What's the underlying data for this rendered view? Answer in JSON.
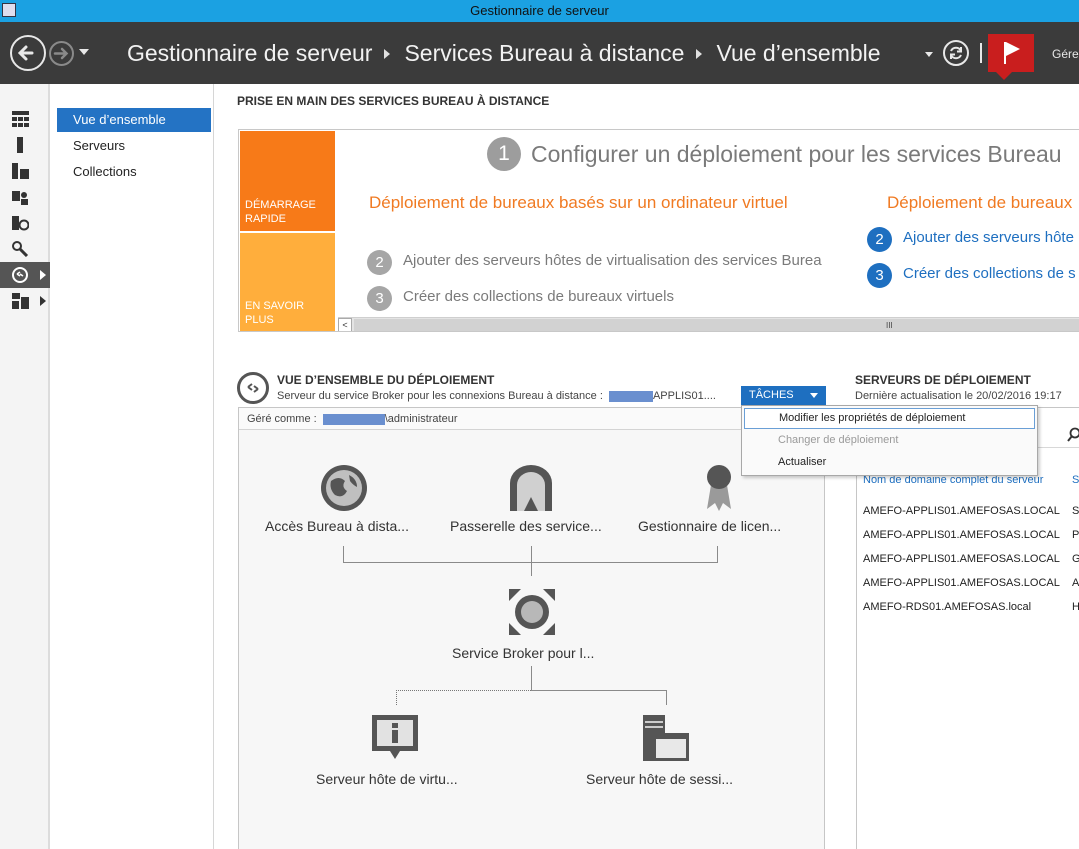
{
  "window": {
    "title": "Gestionnaire de serveur"
  },
  "header": {
    "breadcrumb": [
      "Gestionnaire de serveur",
      "Services Bureau à distance",
      "Vue d’ensemble"
    ],
    "manage_label": "Gére"
  },
  "sidenav": {
    "items": [
      {
        "label": "Vue d’ensemble",
        "active": true
      },
      {
        "label": "Serveurs",
        "active": false
      },
      {
        "label": "Collections",
        "active": false
      }
    ]
  },
  "quickstart": {
    "section_title": "PRISE EN MAIN DES SERVICES BUREAU À DISTANCE",
    "tile_quick": [
      "DÉMARRAGE",
      "RAPIDE"
    ],
    "tile_learn": [
      "EN SAVOIR",
      "PLUS"
    ],
    "main_step_num": "1",
    "main_step_text": "Configurer un déploiement pour les services Bureau",
    "col1_heading": "Déploiement de bureaux basés sur un ordinateur virtuel",
    "col1_steps": [
      {
        "num": "2",
        "text": "Ajouter des serveurs hôtes de virtualisation des services Burea"
      },
      {
        "num": "3",
        "text": "Créer des collections de bureaux virtuels"
      }
    ],
    "col2_heading": "Déploiement de bureaux",
    "col2_steps": [
      {
        "num": "2",
        "text": "Ajouter des serveurs hôte"
      },
      {
        "num": "3",
        "text": "Créer des collections de s"
      }
    ],
    "scroll_left": "<",
    "scroll_grip": "III"
  },
  "deployment": {
    "title": "VUE D’ENSEMBLE DU DÉPLOIEMENT",
    "subtitle": "Serveur du service Broker pour les connexions Bureau à distance :",
    "subtitle_server": "APPLIS01....",
    "tasks_label": "TÂCHES",
    "managed_as": "Géré comme :",
    "managed_user": "\\administrateur",
    "nodes": {
      "web_access": "Accès Bureau à dista...",
      "gateway": "Passerelle des service...",
      "licensing": "Gestionnaire de licen...",
      "broker": "Service Broker pour l...",
      "virt_host": "Serveur hôte de virtu...",
      "session_host": "Serveur hôte de sessi..."
    }
  },
  "tasks_menu": {
    "items": [
      {
        "label": "Modifier les propriétés de déploiement",
        "highlighted": true,
        "enabled": true
      },
      {
        "label": "Changer de déploiement",
        "highlighted": false,
        "enabled": false
      },
      {
        "label": "Actualiser",
        "highlighted": false,
        "enabled": true
      }
    ]
  },
  "servers": {
    "title": "SERVEURS DE DÉPLOIEMENT",
    "subtitle": "Dernière actualisation le 20/02/2016 19:17",
    "column_fqdn": "Nom de domaine complet du serveur",
    "column_2": "S",
    "rows": [
      {
        "fqdn": "AMEFO-APPLIS01.AMEFOSAS.LOCAL",
        "col2": "S"
      },
      {
        "fqdn": "AMEFO-APPLIS01.AMEFOSAS.LOCAL",
        "col2": "P"
      },
      {
        "fqdn": "AMEFO-APPLIS01.AMEFOSAS.LOCAL",
        "col2": "G"
      },
      {
        "fqdn": "AMEFO-APPLIS01.AMEFOSAS.LOCAL",
        "col2": "A"
      },
      {
        "fqdn": "AMEFO-RDS01.AMEFOSAS.local",
        "col2": "H"
      }
    ]
  },
  "colors": {
    "accent_blue": "#1e6fc0",
    "quick_orange": "#f77a18",
    "learn_orange": "#ffae3c",
    "header_bg": "#3b3b3b",
    "flag_red": "#c91e1e"
  }
}
